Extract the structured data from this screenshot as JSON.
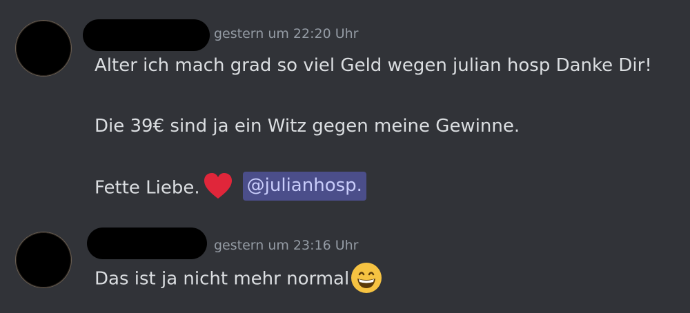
{
  "messages": [
    {
      "timestamp": "gestern um 22:20 Uhr",
      "line1": "Alter ich mach grad so viel Geld wegen julian hosp Danke Dir!",
      "line2": "Die 39€ sind ja ein Witz gegen meine Gewinne.",
      "line3": "Fette Liebe.",
      "emoji": "heart-icon",
      "mention": "@julianhosp."
    },
    {
      "timestamp": "gestern um 23:16 Uhr",
      "line1": "Das ist ja nicht mehr normal",
      "emoji": "grinning-face-icon"
    }
  ],
  "colors": {
    "background": "#313338",
    "text": "#dbdee1",
    "timestamp": "#949ba4",
    "mention_bg": "#4b4e8a",
    "mention_text": "#c9cdfb",
    "heart": "#e0263a",
    "grin": "#f6c342"
  }
}
